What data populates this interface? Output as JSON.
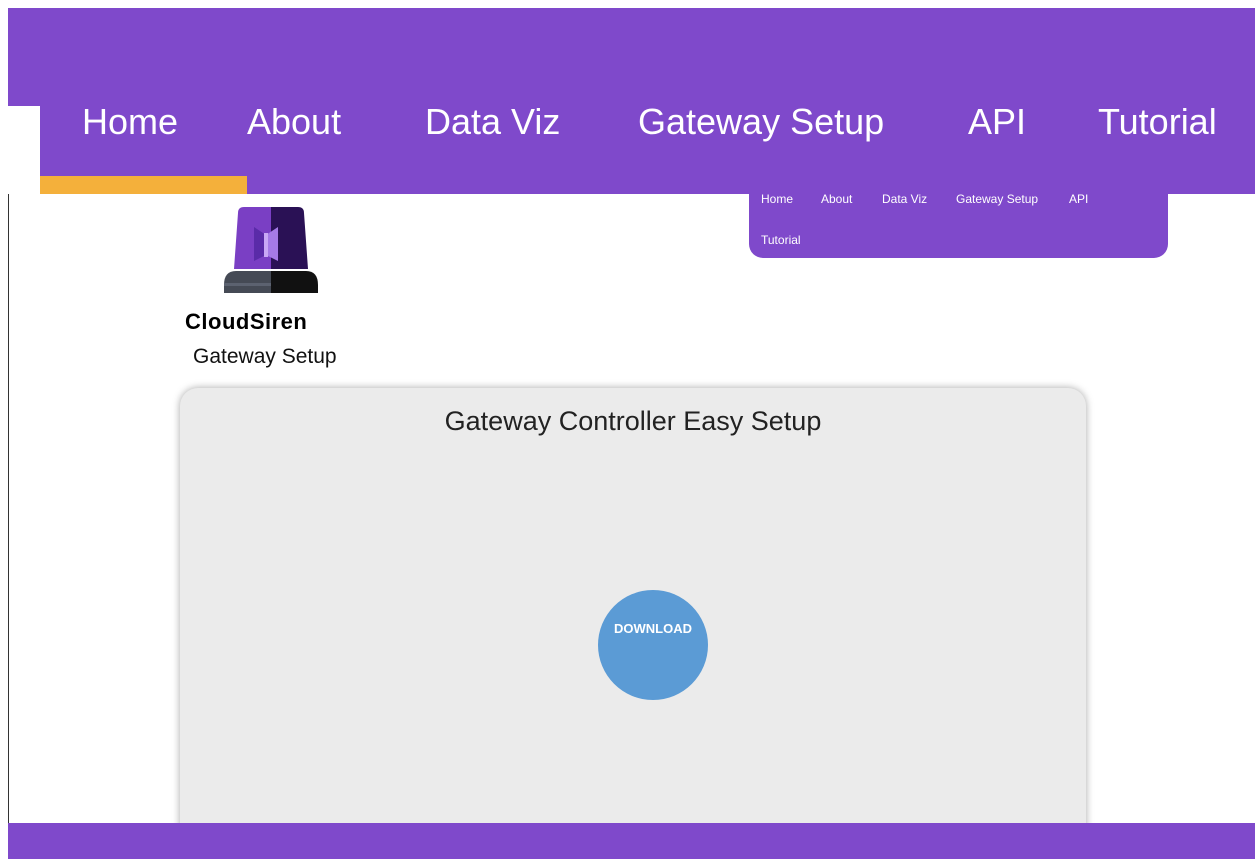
{
  "nav": {
    "items": [
      "Home",
      "About",
      "Data Viz",
      "Gateway Setup",
      "API",
      "Tutorial"
    ],
    "active": "Home"
  },
  "dropdown_nav": {
    "items": [
      "Home",
      "About",
      "Data Viz",
      "Gateway Setup",
      "API",
      "Tutorial"
    ]
  },
  "brand": {
    "name": "CloudSiren",
    "page_subtitle": "Gateway Setup",
    "logo_icon": "siren-icon"
  },
  "card": {
    "title": "Gateway Controller Easy Setup",
    "download_label": "DOWNLOAD"
  },
  "colors": {
    "primary_purple": "#7f49cb",
    "active_accent": "#f4b03b",
    "card_bg": "#ebebeb",
    "download_button": "#5b9bd5"
  }
}
